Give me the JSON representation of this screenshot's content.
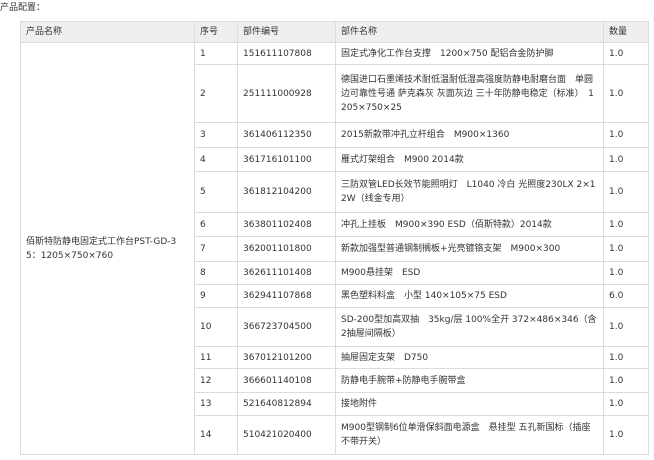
{
  "header": {
    "label": "产品配置："
  },
  "columns": {
    "product": "产品名称",
    "seq": "序号",
    "code": "部件编号",
    "name": "部件名称",
    "qty": "数量"
  },
  "product": {
    "name": "佰斯特防静电固定式工作台PST-GD-35：1205×750×760"
  },
  "rows": [
    {
      "seq": "1",
      "code": "151611107808",
      "name": "固定式净化工作台支撑　1200×750 配铝合金防护脚",
      "qty": "1.0"
    },
    {
      "seq": "2",
      "code": "251111000928",
      "name": "德国进口石墨烯技术耐低温耐低湿高强度防静电耐磨台面　单圆边可靠性号通 萨克森灰 灰面灰边 三十年防静电稳定（标准）　1205×750×25",
      "qty": "1.0"
    },
    {
      "seq": "3",
      "code": "361406112350",
      "name": "2015新款带冲孔立杆组合　M900×1360",
      "qty": "1.0"
    },
    {
      "seq": "4",
      "code": "361716101100",
      "name": "雁式灯架组合　M900 2014款",
      "qty": "1.0"
    },
    {
      "seq": "5",
      "code": "361812104200",
      "name": "三防双管LED长效节能照明灯　L1040 冷白 光照度230LX 2×12W（线金专用）",
      "qty": "1.0"
    },
    {
      "seq": "6",
      "code": "363801102408",
      "name": "冲孔上挂板　M900×390 ESD（佰斯特款）2014款",
      "qty": "1.0"
    },
    {
      "seq": "7",
      "code": "362001101800",
      "name": "新款加强型普通钢制搁板+光亮镀铬支架　M900×300",
      "qty": "1.0"
    },
    {
      "seq": "8",
      "code": "362611101408",
      "name": "M900悬挂架　ESD",
      "qty": "1.0"
    },
    {
      "seq": "9",
      "code": "362941107868",
      "name": "黑色塑料料盒　小型 140×105×75 ESD",
      "qty": "6.0"
    },
    {
      "seq": "10",
      "code": "366723704500",
      "name": "SD-200型加高双抽　35kg/层 100%全开 372×486×346（含2抽屉间隔板）",
      "qty": "1.0"
    },
    {
      "seq": "11",
      "code": "367012101200",
      "name": "抽屉固定支架　D750",
      "qty": "1.0"
    },
    {
      "seq": "12",
      "code": "366601140108",
      "name": "防静电手腕带+防静电手腕带盒",
      "qty": "1.0"
    },
    {
      "seq": "13",
      "code": "521640812894",
      "name": "接地附件",
      "qty": "1.0"
    },
    {
      "seq": "14",
      "code": "510421020400",
      "name": "M900型钢制6位单滑保斜面电源盒　悬挂型 五孔新国标（插座不带开关）",
      "qty": "1.0"
    }
  ]
}
